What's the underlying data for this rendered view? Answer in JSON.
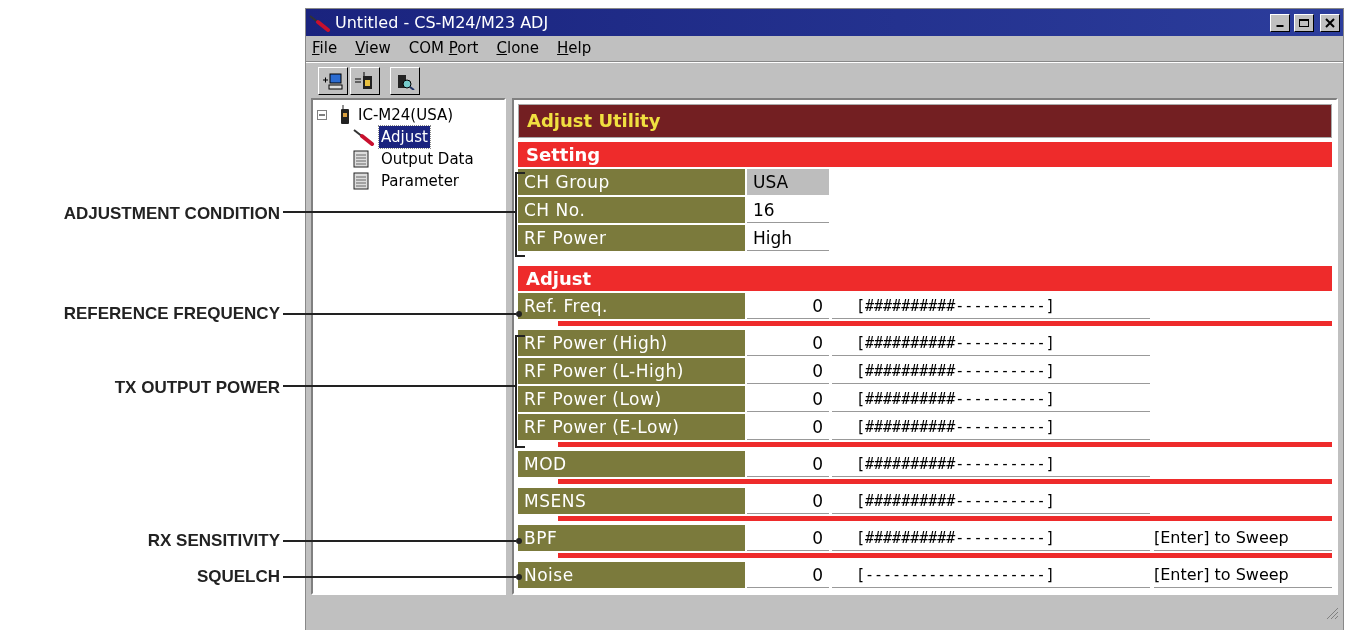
{
  "annotations": [
    {
      "label": "ADJUSTMENT CONDITION",
      "kind": "bracket"
    },
    {
      "label": "REFERENCE FREQUENCY",
      "kind": "dot"
    },
    {
      "label": "TX OUTPUT POWER",
      "kind": "bracket"
    },
    {
      "label": "RX SENSITIVITY",
      "kind": "dot"
    },
    {
      "label": "SQUELCH",
      "kind": "dot"
    }
  ],
  "window": {
    "title": "Untitled - CS-M24/M23 ADJ"
  },
  "menu": [
    {
      "key": "F",
      "post": "ile"
    },
    {
      "key": "V",
      "post": "iew"
    },
    {
      "pre": "COM ",
      "key": "P",
      "post": "ort"
    },
    {
      "key": "C",
      "post": "lone"
    },
    {
      "key": "H",
      "post": "elp"
    }
  ],
  "tree": {
    "label": "IC-M24(USA)",
    "expanded": true,
    "children": [
      {
        "label": "Adjust",
        "kind": "tool",
        "selected": true
      },
      {
        "label": "Output Data",
        "kind": "sheet",
        "selected": false
      },
      {
        "label": "Parameter",
        "kind": "sheet",
        "selected": false
      }
    ]
  },
  "panel": {
    "title": "Adjust Utility",
    "setting": {
      "title": "Setting",
      "rows": [
        {
          "label": "CH Group",
          "value": "USA",
          "kind": "fixed"
        },
        {
          "label": "CH No.",
          "value": "16",
          "kind": "field"
        },
        {
          "label": "RF Power",
          "value": "High",
          "kind": "field"
        }
      ]
    },
    "adjust": {
      "title": "Adjust",
      "groups": [
        [
          {
            "label": "Ref. Freq.",
            "value": "0",
            "bar": "[##########----------]"
          }
        ],
        [
          {
            "label": "RF Power (High)",
            "value": "0",
            "bar": "[##########----------]"
          },
          {
            "label": "RF Power (L-High)",
            "value": "0",
            "bar": "[##########----------]"
          },
          {
            "label": "RF Power (Low)",
            "value": "0",
            "bar": "[##########----------]"
          },
          {
            "label": "RF Power (E-Low)",
            "value": "0",
            "bar": "[##########----------]"
          }
        ],
        [
          {
            "label": "MOD",
            "value": "0",
            "bar": "[##########----------]"
          }
        ],
        [
          {
            "label": "MSENS",
            "value": "0",
            "bar": "[##########----------]"
          }
        ],
        [
          {
            "label": "BPF",
            "value": "0",
            "bar": "[##########----------]",
            "note": "[Enter] to Sweep"
          }
        ],
        [
          {
            "label": "Noise",
            "value": "0",
            "bar": "[--------------------]",
            "note": "[Enter] to Sweep"
          }
        ]
      ]
    }
  }
}
